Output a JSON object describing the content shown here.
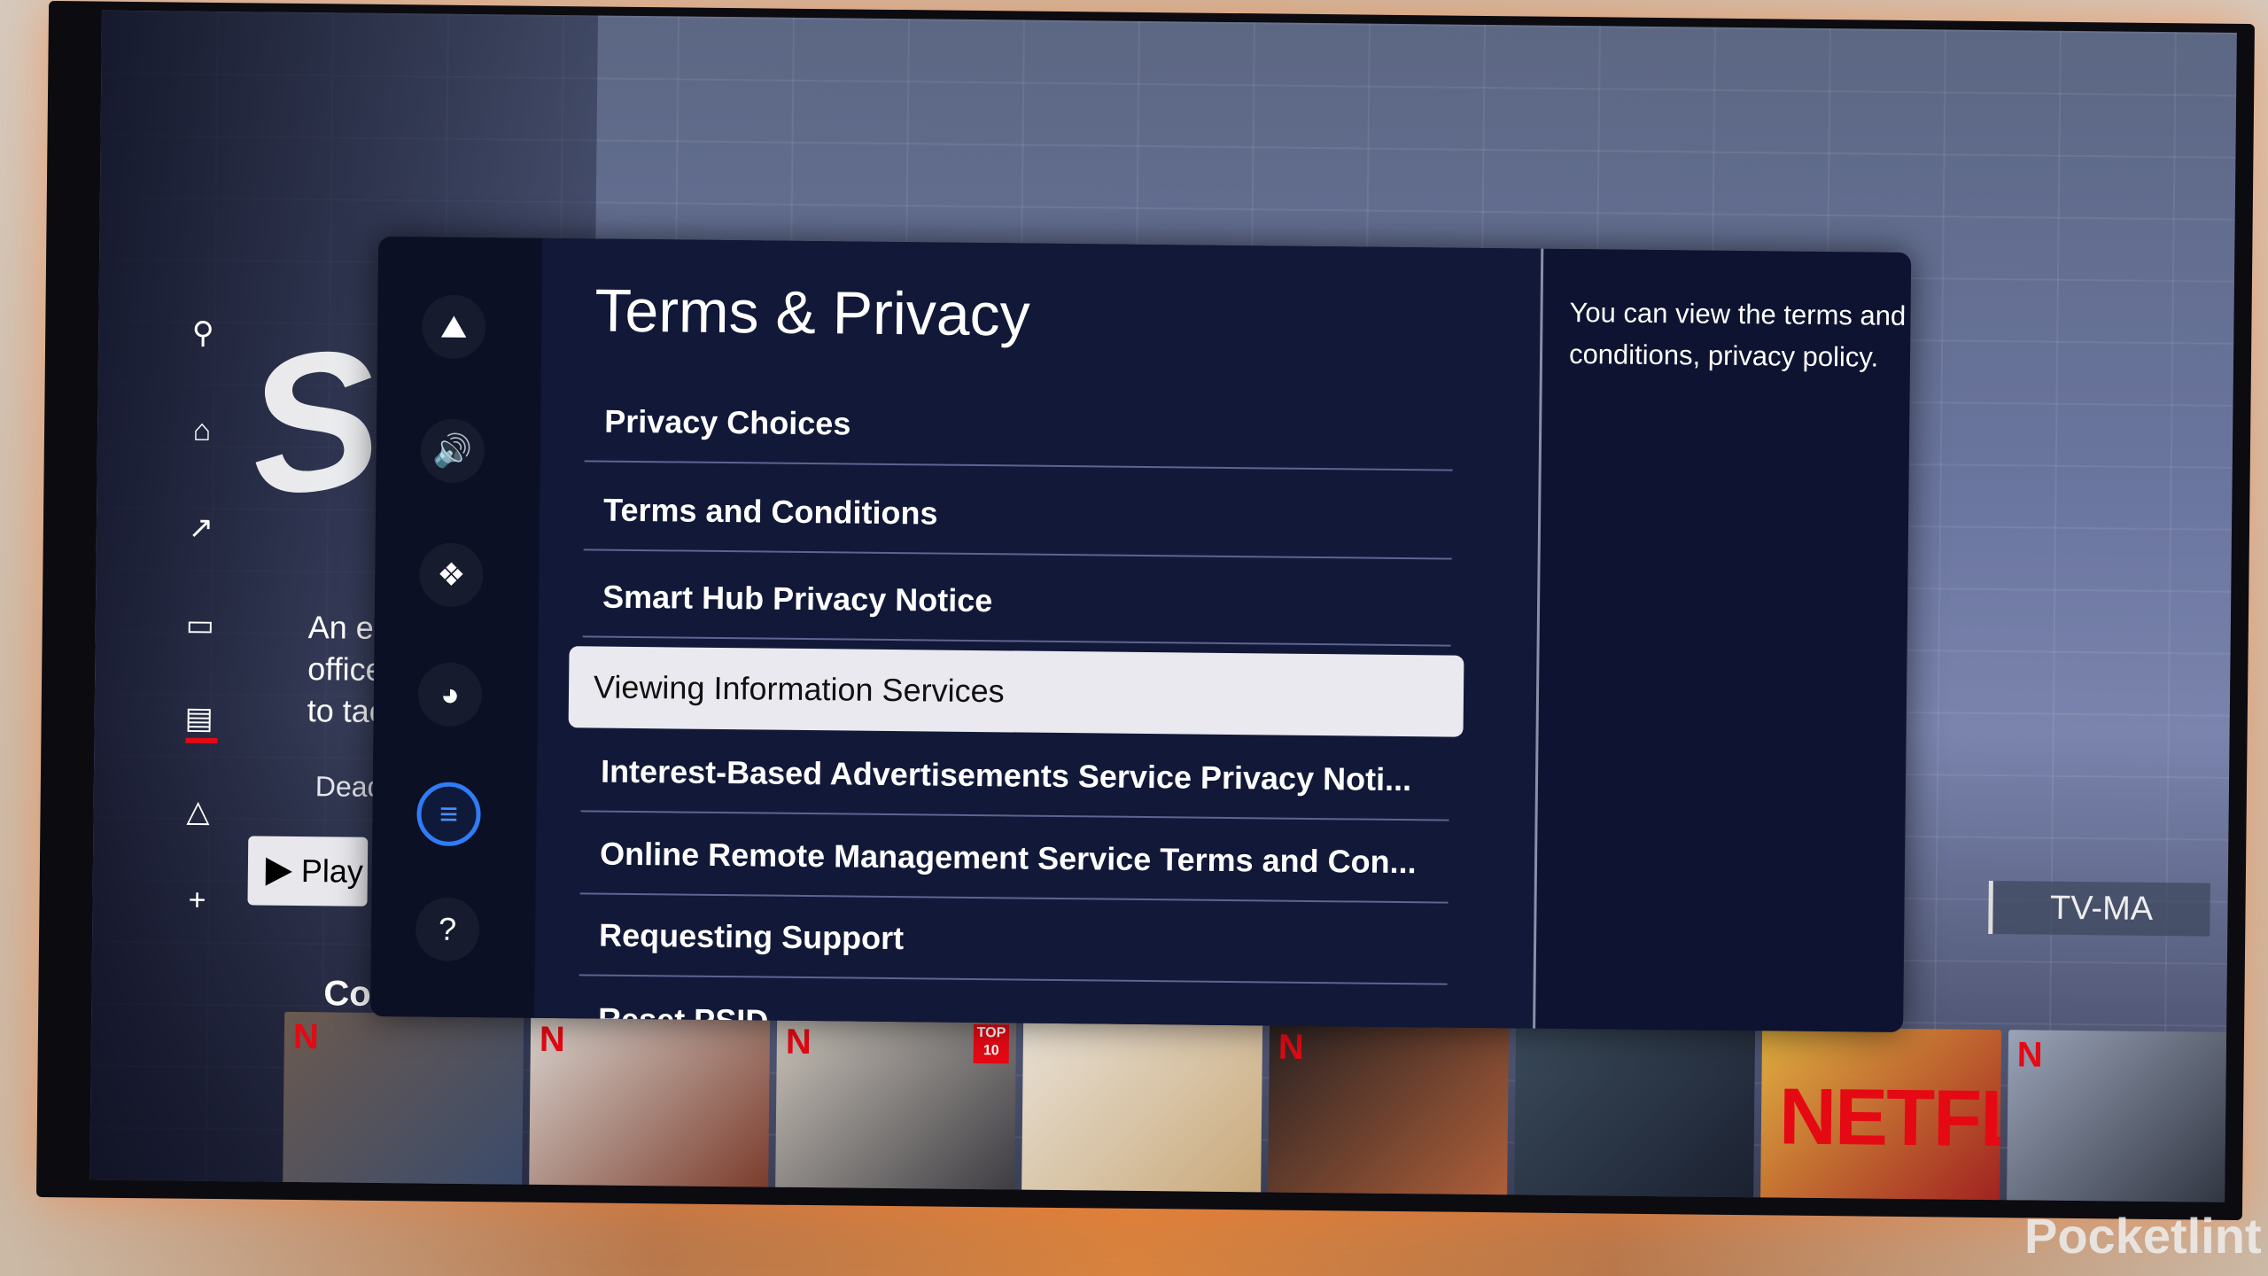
{
  "left_nav": {
    "icons": [
      "search-icon",
      "home-icon",
      "trending-icon",
      "tv-icon",
      "clapperboard-icon",
      "shapes-icon",
      "plus-icon"
    ],
    "active": "home",
    "accent": "#e50914"
  },
  "hero": {
    "description": "An eccentric genius\nofficer teams up\nto tackle crimes",
    "description_lines": [
      "An eccer",
      "officer te",
      "to tackle"
    ],
    "genre": "Deadpan",
    "play_label": "Play",
    "row_title": "Continu",
    "rating": "TV-MA"
  },
  "settings": {
    "icons": [
      "picture-icon",
      "sound-icon",
      "connection-icon",
      "broadcast-icon",
      "general-privacy-icon",
      "support-icon"
    ],
    "active_icon": "general-privacy-icon",
    "title": "Terms & Privacy",
    "items": [
      {
        "label": "Privacy Choices"
      },
      {
        "label": "Terms and Conditions"
      },
      {
        "label": "Smart Hub Privacy Notice"
      },
      {
        "label": "Viewing Information Services",
        "selected": true
      },
      {
        "label": "Interest-Based Advertisements Service Privacy Noti..."
      },
      {
        "label": "Online Remote Management Service Terms and Con..."
      },
      {
        "label": "Requesting Support"
      },
      {
        "label": "Reset PSID"
      }
    ],
    "description": "You can view the terms and conditions, privacy policy.",
    "accent": "#2f7cf6"
  },
  "thumbnails": [
    {
      "badge": "N"
    },
    {
      "badge": "N"
    },
    {
      "badge": "N",
      "top10": "TOP 10"
    },
    {
      "badge": ""
    },
    {
      "badge": "N"
    },
    {
      "badge": ""
    },
    {
      "badge": "",
      "logo": "NETFLIX"
    },
    {
      "badge": "N"
    }
  ],
  "watermark": "Pocketlint"
}
